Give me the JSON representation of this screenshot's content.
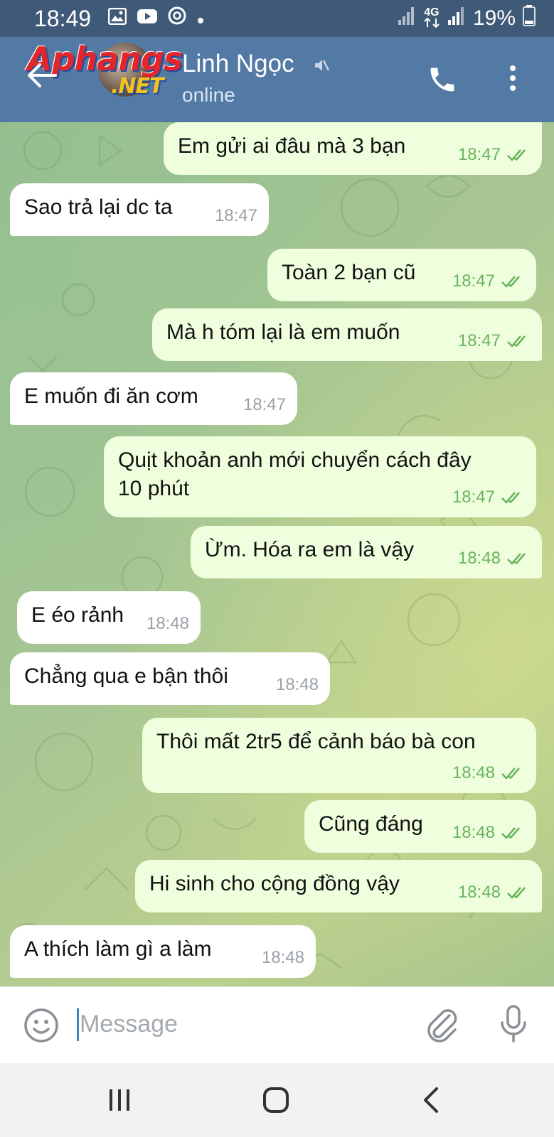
{
  "status_bar": {
    "time": "18:49",
    "network": "4G",
    "battery": "19%",
    "icons": [
      "gallery-icon",
      "youtube-icon",
      "chrome-icon",
      "dot-icon",
      "signal-icon",
      "battery-icon"
    ]
  },
  "header": {
    "watermark_main": "Aphangs",
    "watermark_sub": ".NET",
    "contact_name": "Linh Ngọc",
    "contact_status": "online",
    "icons": [
      "back-arrow-icon",
      "mute-icon",
      "phone-icon",
      "more-vert-icon"
    ],
    "colors": {
      "header_bg": "#527aa4",
      "status_bg": "#3f5a78"
    }
  },
  "messages": [
    {
      "dir": "out",
      "text": "Em gửi ai đâu mà 3 bạn",
      "time": "18:47",
      "read": true
    },
    {
      "dir": "in",
      "text": "Sao trả lại dc ta",
      "time": "18:47"
    },
    {
      "dir": "out",
      "text": "Toàn 2 bạn cũ",
      "time": "18:47",
      "read": true
    },
    {
      "dir": "out",
      "text": "Mà h tóm lại là em muốn",
      "time": "18:47",
      "read": true
    },
    {
      "dir": "in",
      "text": "E muốn đi ăn cơm",
      "time": "18:47"
    },
    {
      "dir": "out",
      "text": "Quịt khoản anh mới chuyển cách đây\n10 phút",
      "time": "18:47",
      "read": true
    },
    {
      "dir": "out",
      "text": "Ừm. Hóa ra em là vậy",
      "time": "18:48",
      "read": true
    },
    {
      "dir": "in",
      "text": "E éo rảnh",
      "time": "18:48"
    },
    {
      "dir": "in",
      "text": "Chẳng qua e bận thôi",
      "time": "18:48"
    },
    {
      "dir": "out",
      "text": "Thôi mất 2tr5 để cảnh báo bà con",
      "time": "18:48",
      "read": true
    },
    {
      "dir": "out",
      "text": "Cũng đáng",
      "time": "18:48",
      "read": true
    },
    {
      "dir": "out",
      "text": "Hi sinh cho cộng đồng vậy",
      "time": "18:48",
      "read": true
    },
    {
      "dir": "in",
      "text": "A thích làm gì a làm",
      "time": "18:48"
    }
  ],
  "input_bar": {
    "placeholder": "Message",
    "icons": [
      "emoji-icon",
      "attach-icon",
      "microphone-icon"
    ]
  },
  "nav_bar": {
    "icons": [
      "recents-icon",
      "home-icon",
      "back-icon"
    ]
  },
  "colors": {
    "outgoing_bubble": "#efffde",
    "incoming_bubble": "#ffffff",
    "read_check": "#6ab35e",
    "incoming_time": "#9aa1a8"
  }
}
